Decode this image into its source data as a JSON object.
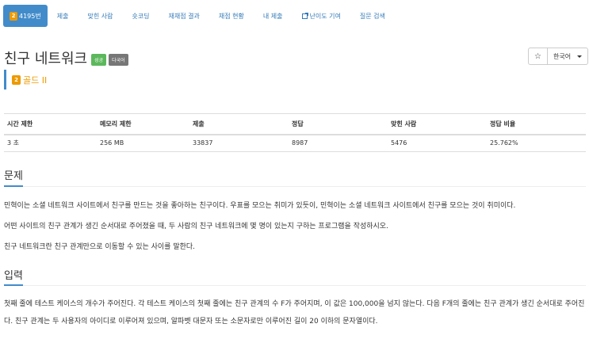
{
  "tabs": [
    {
      "label": "4195번",
      "tier": "2",
      "active": true
    },
    {
      "label": "제출"
    },
    {
      "label": "맞힌 사람"
    },
    {
      "label": "숏코딩"
    },
    {
      "label": "재채점 결과"
    },
    {
      "label": "채점 현황"
    },
    {
      "label": "내 제출"
    },
    {
      "label": "난이도 기여",
      "external": true
    },
    {
      "label": "질문 검색"
    }
  ],
  "problem": {
    "title": "친구 네트워크",
    "badges": {
      "success": "성공",
      "lang": "다국어"
    },
    "tier_label": "골드 II",
    "tier_num": "2"
  },
  "controls": {
    "star": "☆",
    "language": "한국어"
  },
  "info_table": {
    "headers": [
      "시간 제한",
      "메모리 제한",
      "제출",
      "정답",
      "맞힌 사람",
      "정답 비율"
    ],
    "values": [
      "3 초",
      "256 MB",
      "33837",
      "8987",
      "5476",
      "25.762%"
    ]
  },
  "sections": {
    "problem_heading": "문제",
    "problem_paragraphs": [
      "민혁이는 소셜 네트워크 사이트에서 친구를 만드는 것을 좋아하는 친구이다. 우표를 모으는 취미가 있듯이, 민혁이는 소셜 네트워크 사이트에서 친구를 모으는 것이 취미이다.",
      "어떤 사이트의 친구 관계가 생긴 순서대로 주어졌을 때, 두 사람의 친구 네트워크에 몇 명이 있는지 구하는 프로그램을 작성하시오.",
      "친구 네트워크란 친구 관계만으로 이동할 수 있는 사이를 말한다."
    ],
    "input_heading": "입력",
    "input_paragraph": "첫째 줄에 테스트 케이스의 개수가 주어진다. 각 테스트 케이스의 첫째 줄에는 친구 관계의 수 F가 주어지며, 이 값은 100,000을 넘지 않는다. 다음 F개의 줄에는 친구 관계가 생긴 순서대로 주어진다. 친구 관계는 두 사용자의 아이디로 이루어져 있으며, 알파벳 대문자 또는 소문자로만 이루어진 길이 20 이하의 문자열이다."
  },
  "colors": {
    "accent": "#428bca",
    "tier_gold": "#ec9a00",
    "success": "#5cb85c",
    "lang_badge": "#777777"
  }
}
